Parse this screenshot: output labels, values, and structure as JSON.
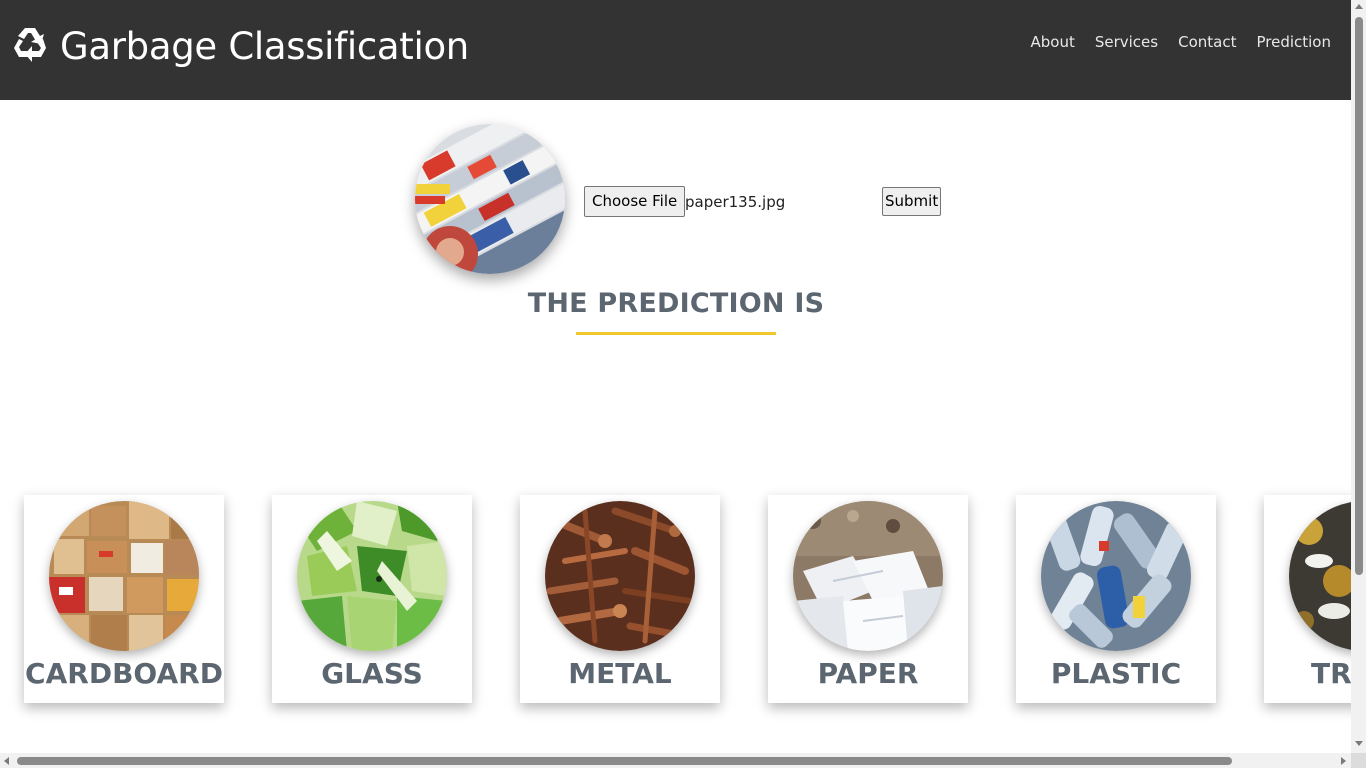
{
  "header": {
    "brand_icon": "recycle-icon",
    "title": "Garbage Classification",
    "nav": [
      "About",
      "Services",
      "Contact",
      "Prediction"
    ],
    "background_color": "#333333"
  },
  "upload": {
    "preview_image": "newspaper-image",
    "choose_label": "Choose File",
    "file_name": "paper135.jpg",
    "submit_label": "Submit"
  },
  "prediction": {
    "heading": "THE PREDICTION IS",
    "result": "",
    "accent_color": "#f0c82e"
  },
  "categories": [
    {
      "label": "CARDBOARD",
      "image": "cardboard-boxes-image"
    },
    {
      "label": "GLASS",
      "image": "glass-shards-image"
    },
    {
      "label": "METAL",
      "image": "metal-screws-image"
    },
    {
      "label": "PAPER",
      "image": "paper-waste-image"
    },
    {
      "label": "PLASTIC",
      "image": "plastic-bottles-image"
    },
    {
      "label": "TRASH",
      "image": "trash-image"
    }
  ],
  "colors": {
    "heading_text": "#5c6670",
    "header_text": "#ffffff"
  }
}
